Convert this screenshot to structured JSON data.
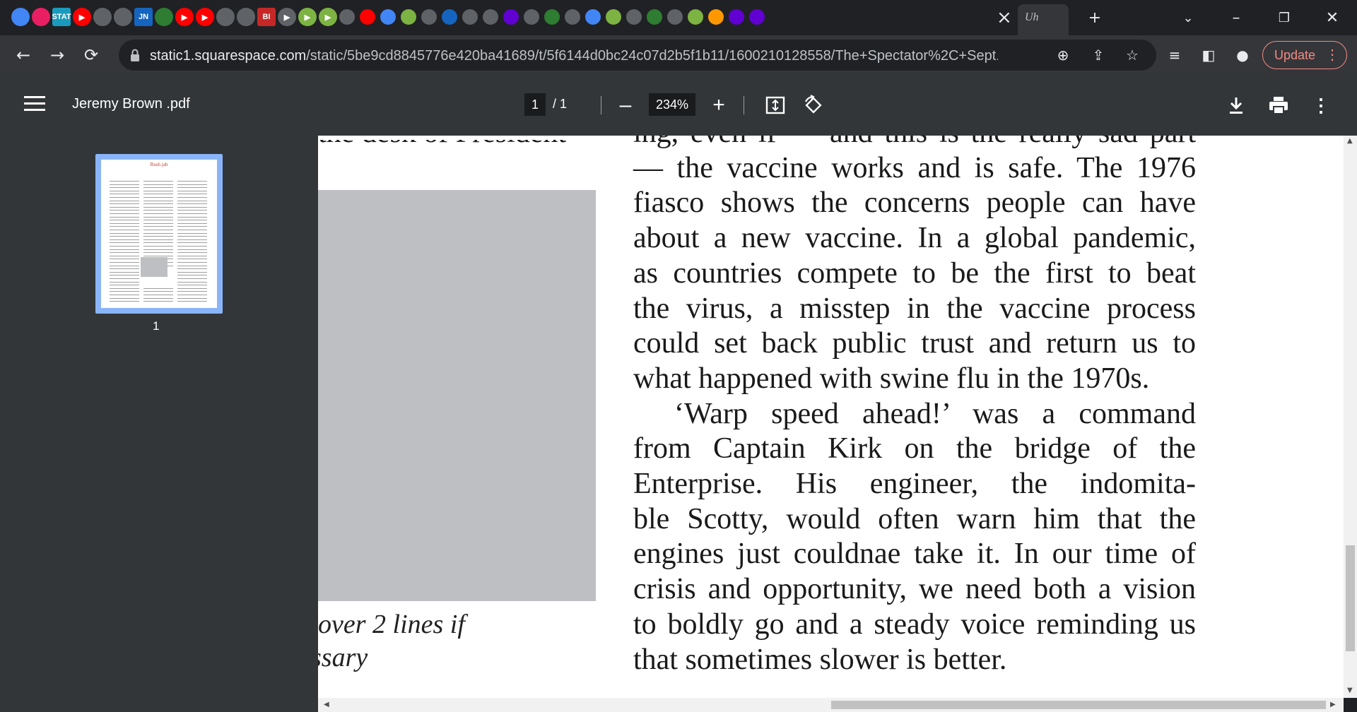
{
  "tabs": {
    "items": [
      {
        "icon": "globe-icon",
        "color": "#4285f4",
        "label": ""
      },
      {
        "icon": "flower-icon",
        "color": "#e91e63",
        "label": ""
      },
      {
        "icon": "stat-icon",
        "color": "#1a9bbd",
        "label": "STAT"
      },
      {
        "icon": "youtube-icon",
        "color": "#ff0000",
        "label": "▶"
      },
      {
        "icon": "globe-icon",
        "color": "#5f6368",
        "label": ""
      },
      {
        "icon": "globe-icon",
        "color": "#5f6368",
        "label": ""
      },
      {
        "icon": "jn-icon",
        "color": "#1565c0",
        "label": "JN"
      },
      {
        "icon": "shield-icon",
        "color": "#2e7d32",
        "label": ""
      },
      {
        "icon": "youtube-icon",
        "color": "#ff0000",
        "label": "▶"
      },
      {
        "icon": "youtube-icon",
        "color": "#ff0000",
        "label": "▶"
      },
      {
        "icon": "globe-icon",
        "color": "#5f6368",
        "label": ""
      },
      {
        "icon": "globe-icon",
        "color": "#5f6368",
        "label": ""
      },
      {
        "icon": "bi-icon",
        "color": "#c62828",
        "label": "BI"
      },
      {
        "icon": "chevron-icon",
        "color": "#5f6368",
        "label": "▶"
      },
      {
        "icon": "play-icon",
        "color": "#7cb342",
        "label": "▶"
      },
      {
        "icon": "play-icon",
        "color": "#7cb342",
        "label": "▶"
      }
    ],
    "active_label": "Uh",
    "close_glyph": "×",
    "new_tab_glyph": "+"
  },
  "window_controls": {
    "dropdown": "⌄",
    "minimize": "–",
    "restore": "❐",
    "close": "✕"
  },
  "toolbar": {
    "back": "←",
    "forward": "→",
    "reload": "⟳",
    "url_host": "static1.squarespace.com",
    "url_path": "/static/5be9cd8845776e420ba41689/t/5f6144d0bc24c07d2b5f1b11/1600210128558/The+Spectator%2C+Sept...",
    "update_label": "Update"
  },
  "pdf": {
    "title": "Jeremy Brown .pdf",
    "page_current": "1",
    "page_total": "/ 1",
    "zoom": "234%",
    "thumbnail_number": "1",
    "thumbnail_heading": "Rush jab"
  },
  "document": {
    "top_left_fragment": "the desk of President",
    "caption_line1": "over 2 lines if",
    "caption_line2": "ssary",
    "lines": [
      "ing, even if — and this is the really sad part",
      "— the vaccine works and is safe. The 1976",
      "fiasco shows the concerns people can have",
      "about a new vaccine. In a global pandemic,",
      "as countries compete to be the first to beat",
      "the virus, a misstep in the vaccine process",
      "could set back public trust and return us to",
      "what happened with swine flu in the 1970s.",
      "‘Warp speed ahead!’ was a command",
      "from Captain Kirk on the bridge of the",
      "Enterprise. His engineer, the indomita-",
      "ble Scotty, would often warn him that the",
      "engines just couldnae take it. In our time of",
      "crisis and opportunity, we need both a vision",
      "to boldly go and a steady voice reminding us",
      "that sometimes slower is better."
    ]
  }
}
